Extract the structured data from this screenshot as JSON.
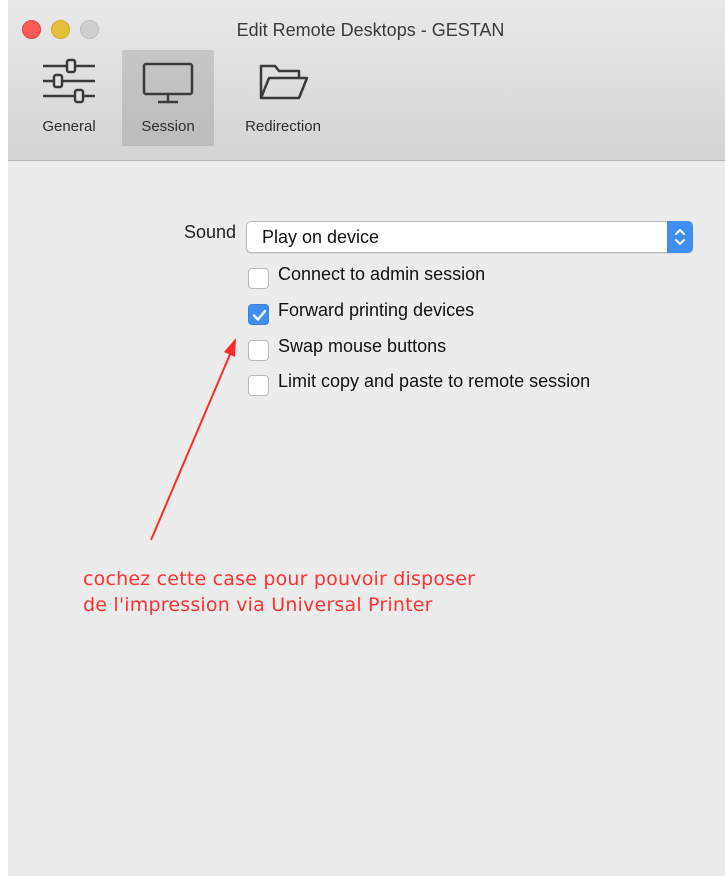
{
  "window": {
    "title": "Edit Remote Desktops - GESTAN"
  },
  "toolbar": {
    "items": [
      {
        "label": "General",
        "icon": "sliders-icon",
        "selected": false
      },
      {
        "label": "Session",
        "icon": "monitor-icon",
        "selected": true
      },
      {
        "label": "Redirection",
        "icon": "folder-icon",
        "selected": false
      }
    ]
  },
  "session": {
    "sound_label": "Sound",
    "sound_value": "Play on device",
    "options": [
      {
        "label": "Connect to admin session",
        "checked": false
      },
      {
        "label": "Forward printing devices",
        "checked": true
      },
      {
        "label": "Swap mouse buttons",
        "checked": false
      },
      {
        "label": "Limit copy and paste to remote session",
        "checked": false
      }
    ]
  },
  "annotation": {
    "line1": "cochez cette case pour pouvoir disposer",
    "line2": "de l'impression via Universal Printer"
  },
  "colors": {
    "accent": "#3f8ff0",
    "annotation": "#ff3131",
    "close": "#fc5b57",
    "minimize": "#e5bf3c"
  }
}
